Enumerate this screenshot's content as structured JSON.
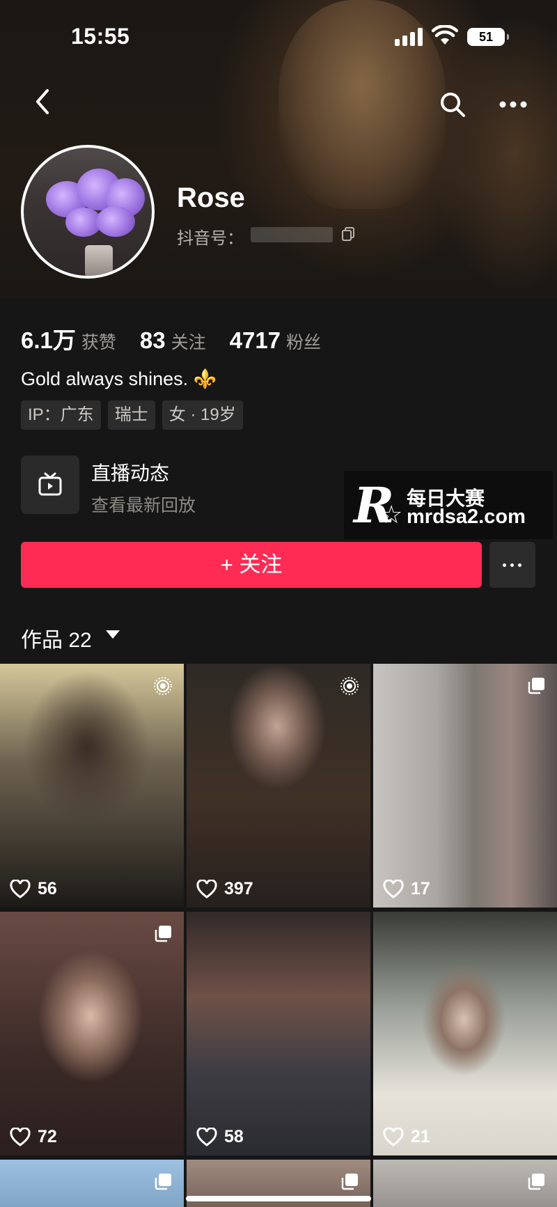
{
  "status_bar": {
    "time": "15:55",
    "battery": "51"
  },
  "profile": {
    "name": "Rose",
    "douyin_id_label": "抖音号：",
    "stats": [
      {
        "value": "6.1万",
        "label": "获赞"
      },
      {
        "value": "83",
        "label": "关注"
      },
      {
        "value": "4717",
        "label": "粉丝"
      }
    ],
    "bio": "Gold always shines. ⚜️",
    "tags": [
      "IP：广东",
      "瑞士",
      "女 · 19岁"
    ]
  },
  "live": {
    "title": "直播动态",
    "subtitle": "查看最新回放"
  },
  "watermark": {
    "logo": "R",
    "title": "每日大赛",
    "url": "mrdsa2.com"
  },
  "actions": {
    "follow_label": "+ 关注"
  },
  "works": {
    "label": "作品 22"
  },
  "videos": [
    {
      "likes": "56",
      "badge": "live"
    },
    {
      "likes": "397",
      "badge": "live"
    },
    {
      "likes": "17",
      "badge": "multi"
    },
    {
      "likes": "72",
      "badge": "multi"
    },
    {
      "likes": "58",
      "badge": "none"
    },
    {
      "likes": "21",
      "badge": "none"
    }
  ],
  "colors": {
    "accent": "#fe2c55",
    "background": "#161616"
  }
}
